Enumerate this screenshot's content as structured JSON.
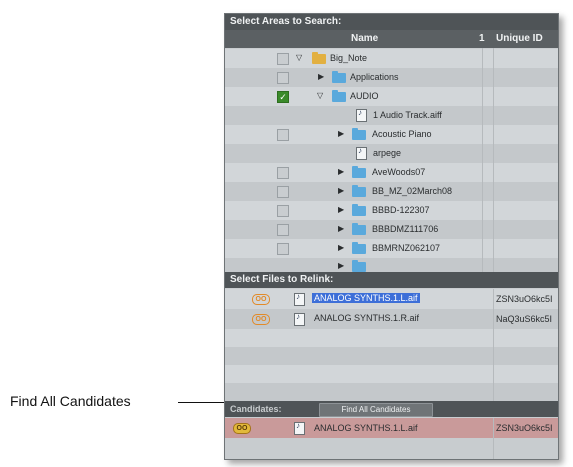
{
  "callout": {
    "label": "Find All Candidates"
  },
  "areas": {
    "header": "Select Areas to Search:",
    "columns": {
      "name": "Name",
      "num": "1",
      "unique_id": "Unique ID"
    },
    "rows": [
      {
        "label": "Big_Note",
        "checked": false,
        "expanded": true,
        "kind": "drive"
      },
      {
        "label": "Applications",
        "checked": false,
        "expanded": false,
        "kind": "folder"
      },
      {
        "label": "AUDIO",
        "checked": true,
        "expanded": true,
        "kind": "folder"
      },
      {
        "label": "1 Audio Track.aiff",
        "kind": "file"
      },
      {
        "label": "Acoustic Piano",
        "checked": false,
        "expanded": false,
        "kind": "folder"
      },
      {
        "label": "arpege",
        "kind": "file"
      },
      {
        "label": "AveWoods07",
        "checked": false,
        "expanded": false,
        "kind": "folder"
      },
      {
        "label": "BB_MZ_02March08",
        "checked": false,
        "expanded": false,
        "kind": "folder"
      },
      {
        "label": "BBBD-122307",
        "checked": false,
        "expanded": false,
        "kind": "folder"
      },
      {
        "label": "BBBDMZ111706",
        "checked": false,
        "expanded": false,
        "kind": "folder"
      },
      {
        "label": "BBMRNZ062107",
        "checked": false,
        "expanded": false,
        "kind": "folder"
      }
    ]
  },
  "relink": {
    "header": "Select Files to Relink:",
    "files": [
      {
        "name": "ANALOG SYNTHS.1.L.aif",
        "unique_id": "ZSN3uO6kc5I"
      },
      {
        "name": "ANALOG SYNTHS.1.R.aif",
        "unique_id": "NaQ3uS6kc5I"
      }
    ]
  },
  "candidates": {
    "label": "Candidates:",
    "button": "Find All Candidates",
    "row": {
      "name": "ANALOG SYNTHS.1.L.aif",
      "unique_id": "ZSN3uO6kc5I"
    }
  },
  "colors": {
    "selection": "#3d6fd8",
    "candidate_row": "#c99a9a",
    "header": "#4f5457"
  }
}
